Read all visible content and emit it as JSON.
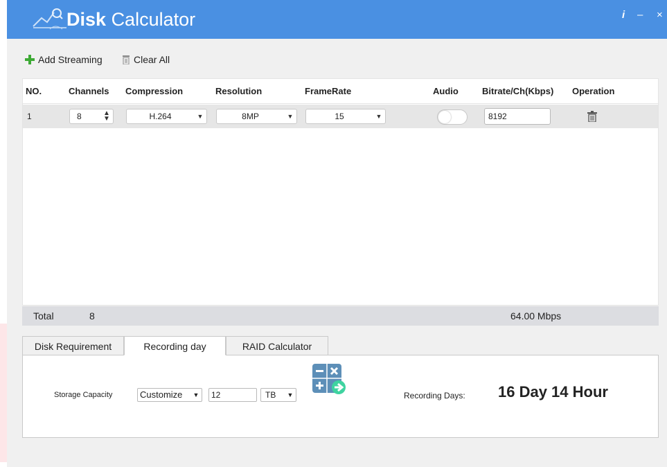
{
  "app": {
    "title_bold": "Disk",
    "title_light": "Calculator",
    "info_icon": "info-icon",
    "minimize_icon": "minimize-icon",
    "close_icon": "close-icon",
    "info_glyph": "i",
    "minimize_glyph": "–",
    "close_glyph": "×"
  },
  "toolbar": {
    "add_label": "Add Streaming",
    "clear_label": "Clear All"
  },
  "table": {
    "headers": [
      "NO.",
      "Channels",
      "Compression",
      "Resolution",
      "FrameRate",
      "Audio",
      "Bitrate/Ch(Kbps)",
      "Operation"
    ],
    "rows": [
      {
        "no": "1",
        "channels": "8",
        "compression": "H.264",
        "resolution": "8MP",
        "framerate": "15",
        "audio_on": false,
        "bitrate": "8192"
      }
    ]
  },
  "total": {
    "label": "Total",
    "channels": "8",
    "bandwidth": "64.00 Mbps"
  },
  "tabs": [
    {
      "label": "Disk Requirement",
      "active": false
    },
    {
      "label": "Recording day",
      "active": true
    },
    {
      "label": "RAID Calculator",
      "active": false
    }
  ],
  "recording_day": {
    "storage_label": "Storage Capacity",
    "mode_value": "Customize",
    "capacity_value": "12",
    "unit_value": "TB",
    "result_label": "Recording Days:",
    "result_value": "16 Day 14 Hour"
  },
  "colors": {
    "titlebar": "#4a90e2",
    "add_icon": "#3daa35",
    "calc_tile": "#5d8fb8",
    "calc_arrow": "#3fd3a0"
  }
}
